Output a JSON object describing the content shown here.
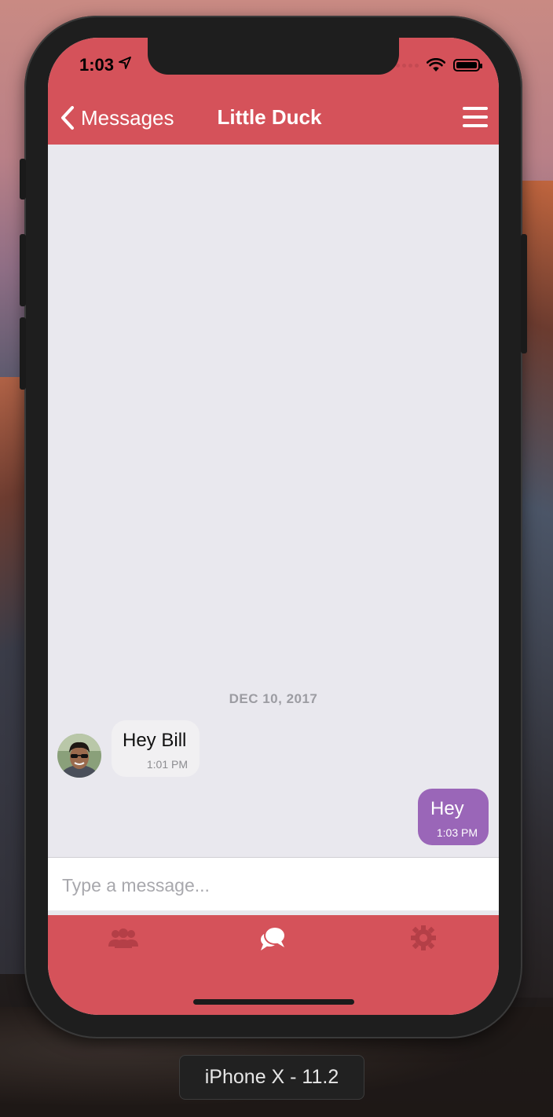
{
  "status_bar": {
    "time": "1:03",
    "location_icon": "location-arrow-icon",
    "wifi_icon": "wifi-icon",
    "battery_icon": "battery-icon"
  },
  "nav": {
    "back_label": "Messages",
    "title": "Little Duck",
    "menu_icon": "hamburger-menu-icon"
  },
  "chat": {
    "date_separator": "DEC 10, 2017",
    "messages": [
      {
        "direction": "incoming",
        "text": "Hey Bill",
        "time": "1:01 PM"
      },
      {
        "direction": "outgoing",
        "text": "Hey",
        "time": "1:03 PM"
      }
    ]
  },
  "composer": {
    "placeholder": "Type a message..."
  },
  "tabbar": {
    "tabs": [
      {
        "icon": "contacts-icon",
        "active": false
      },
      {
        "icon": "chat-bubbles-icon",
        "active": true
      },
      {
        "icon": "gear-icon",
        "active": false
      }
    ]
  },
  "colors": {
    "header": "#d5525a",
    "outgoing_bubble": "#9a66b8",
    "incoming_bubble": "#f1f0f2",
    "chat_bg": "#e9e8ee"
  },
  "simulator": {
    "device_label": "iPhone X - 11.2"
  }
}
